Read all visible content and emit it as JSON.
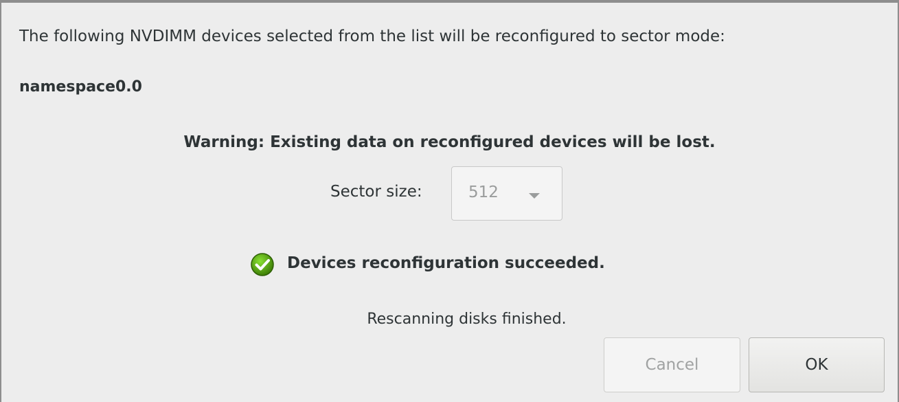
{
  "dialog": {
    "intro_text": "The following NVDIMM devices selected from the list will be reconfigured to sector mode:",
    "device_name": "namespace0.0",
    "warning_text": "Warning: Existing data on reconfigured devices will be lost.",
    "sector_size_label": "Sector size:",
    "sector_size_value": "512",
    "status_text": "Devices reconfiguration succeeded.",
    "status_icon": "success-check-icon",
    "rescan_text": "Rescanning disks finished.",
    "buttons": {
      "cancel_label": "Cancel",
      "ok_label": "OK"
    }
  },
  "colors": {
    "success_green": "#4e9a06",
    "text": "#2e3436",
    "disabled_text": "#9a9c9c"
  }
}
